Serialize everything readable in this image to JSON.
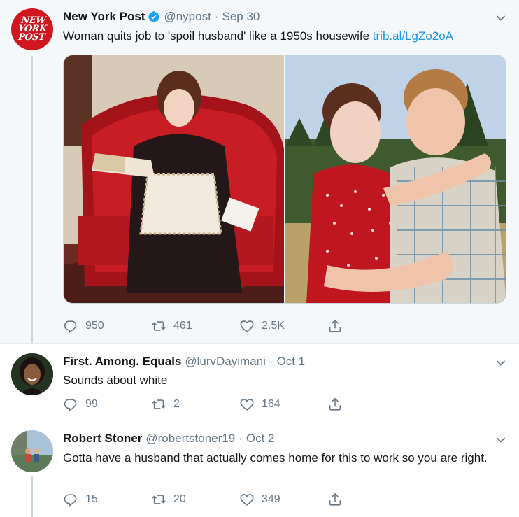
{
  "main_tweet": {
    "name": "New York Post",
    "handle": "@nypost",
    "date": "Sep 30",
    "text": "Woman quits job to 'spoil husband' like a 1950s housewife ",
    "link": "trib.al/LgZo2oA",
    "logo_text": "NEW YORK POST",
    "replies": "950",
    "retweets": "461",
    "likes": "2.5K"
  },
  "replies": [
    {
      "name": "First. Among. Equals",
      "handle": "@lurvDayimani",
      "date": "Oct 1",
      "text": "Sounds about white",
      "replies": "99",
      "retweets": "2",
      "likes": "164"
    },
    {
      "name": "Robert Stoner",
      "handle": "@robertstoner19",
      "date": "Oct 2",
      "text": "Gotta have a husband that actually comes home for this to work so you are right.",
      "replies": "15",
      "retweets": "20",
      "likes": "349"
    }
  ],
  "colors": {
    "link": "#1b95e0",
    "secondary_text": "#657786",
    "brand_nyp": "#d0161f",
    "verified": "#1da1f2"
  },
  "icons": [
    "reply-icon",
    "retweet-icon",
    "like-icon",
    "share-icon",
    "chevron-down-icon",
    "verified-badge-icon"
  ]
}
